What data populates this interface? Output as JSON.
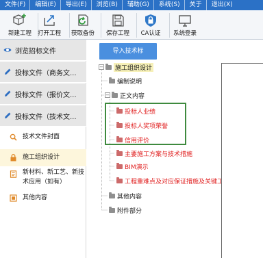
{
  "menubar": {
    "items": [
      "文件(F)",
      "编辑(E)",
      "导出(E)",
      "浏览(B)",
      "辅助(G)",
      "系统(S)",
      "关于",
      "退出(X)"
    ]
  },
  "toolbar": {
    "buttons": [
      {
        "label": "新建工程",
        "icon": "cube-plus-icon"
      },
      {
        "label": "打开工程",
        "icon": "open-export-icon"
      },
      {
        "label": "获取备份",
        "icon": "refresh-backup-icon"
      },
      {
        "label": "保存工程",
        "icon": "save-icon"
      },
      {
        "label": "CA认证",
        "icon": "lock-shield-icon"
      },
      {
        "label": "系统登录",
        "icon": "monitor-icon"
      }
    ]
  },
  "sidebar": {
    "nav": [
      {
        "label": "浏览招标文件",
        "icon": "eye-icon"
      },
      {
        "label": "投标文件（商务文...",
        "icon": "pencil-icon"
      },
      {
        "label": "投标文件（报价文...",
        "icon": "pencil-icon"
      },
      {
        "label": "投标文件（技术文...",
        "icon": "pencil-icon"
      }
    ],
    "sub_items": [
      {
        "label": "技术文件封面",
        "icon": "search-icon"
      },
      {
        "label": "施工组织设计",
        "icon": "lock-icon"
      },
      {
        "label": "新材料、新工艺、新技术应用（如有）",
        "icon": "document-list-icon"
      },
      {
        "label": "其他内容",
        "icon": "document-grid-icon"
      }
    ]
  },
  "content": {
    "import_button": "导入技术标",
    "tree": {
      "root": "施工组织设计",
      "nodes": [
        {
          "label": "编制说明"
        },
        {
          "label": "正文内容"
        },
        {
          "label": "投标人业绩"
        },
        {
          "label": "投标人奖项荣誉"
        },
        {
          "label": "信用评价"
        },
        {
          "label": "主要施工方案与技术措施"
        },
        {
          "label": "BIM演示"
        },
        {
          "label": "工程重难点及对应保证措施及关键工序"
        },
        {
          "label": "其他内容"
        },
        {
          "label": "附件部分"
        }
      ]
    }
  },
  "colors": {
    "menubar_bg": "#2b71c6",
    "import_button_bg": "#4a8fdf",
    "required_text": "#e01e1e",
    "highlight_border": "#3e8a3e",
    "active_sub_bg": "#fdf6dc"
  }
}
